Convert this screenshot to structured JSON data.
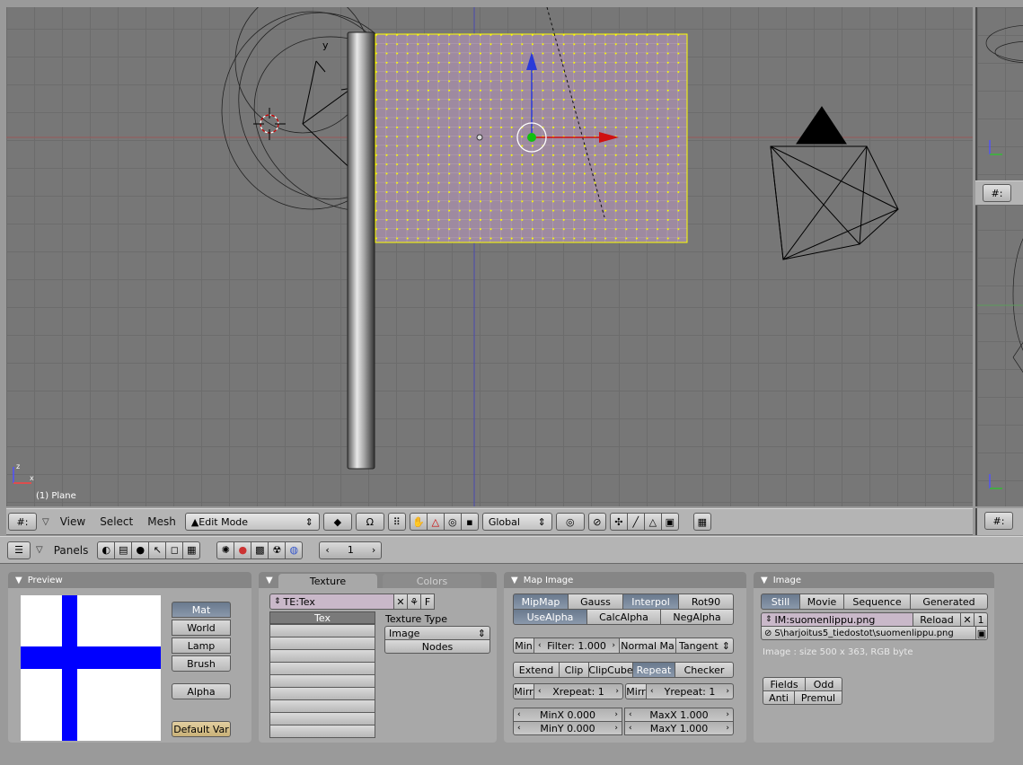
{
  "viewport": {
    "object_label": "(1) Plane",
    "axis_labels": {
      "x": "x",
      "y": "y",
      "z": "z"
    }
  },
  "header_3d": {
    "menus": [
      "View",
      "Select",
      "Mesh"
    ],
    "mode": "Edit Mode",
    "orientation": "Global"
  },
  "header_buttons": {
    "panels_label": "Panels",
    "frame": "1"
  },
  "preview_panel": {
    "title": "Preview",
    "buttons": [
      "Mat",
      "World",
      "Lamp",
      "Brush"
    ],
    "alpha": "Alpha",
    "default_var": "Default Var",
    "flag_colors": {
      "background": "#ffffff",
      "cross": "#0000ff"
    }
  },
  "texture_panel": {
    "tab_active": "Texture",
    "tab_inactive": "Colors",
    "datablock": "TE:Tex",
    "datablock_flags": "F",
    "channel_active": "Tex",
    "type_label": "Texture Type",
    "type_value": "Image",
    "nodes": "Nodes"
  },
  "map_image_panel": {
    "title": "Map Image",
    "row1": [
      "MipMap",
      "Gauss",
      "Interpol",
      "Rot90"
    ],
    "row2": [
      "UseAlpha",
      "CalcAlpha",
      "NegAlpha"
    ],
    "min": "Min",
    "filter": "Filter: 1.000",
    "normal_map": "Normal Ma",
    "tangent": "Tangent",
    "extend_row": [
      "Extend",
      "Clip",
      "ClipCube",
      "Repeat",
      "Checker"
    ],
    "mirr": "Mirr",
    "xrepeat": "Xrepeat: 1",
    "yrepeat": "Yrepeat: 1",
    "minx": "MinX 0.000",
    "maxx": "MaxX 1.000",
    "miny": "MinY 0.000",
    "maxy": "MaxY 1.000"
  },
  "image_panel": {
    "title": "Image",
    "tabs": [
      "Still",
      "Movie",
      "Sequence",
      "Generated"
    ],
    "image_name": "IM:suomenlippu.png",
    "reload": "Reload",
    "users": "1",
    "path": "S\\harjoitus5_tiedostot\\suomenlippu.png",
    "info": "Image : size 500 x 363, RGB byte",
    "fields": "Fields",
    "odd": "Odd",
    "anti": "Anti",
    "premul": "Premul"
  }
}
